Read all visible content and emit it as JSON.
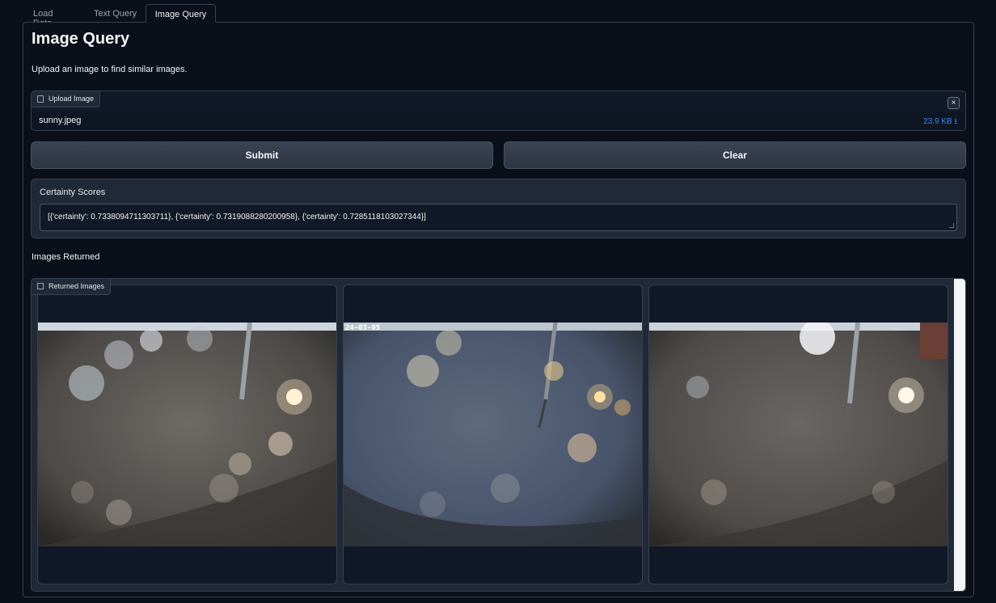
{
  "tabs": [
    {
      "label": "Load Data"
    },
    {
      "label": "Text Query"
    },
    {
      "label": "Image Query"
    }
  ],
  "active_tab": "Image Query",
  "page": {
    "title": "Image Query",
    "description": "Upload an image to find similar images."
  },
  "upload": {
    "label": "Upload Image",
    "icon": "file-icon",
    "file_name": "sunny.jpeg",
    "file_size": "23.9 KB ⭳",
    "close_symbol": "×"
  },
  "buttons": {
    "submit_label": "Submit",
    "clear_label": "Clear"
  },
  "scores": {
    "label": "Certainty Scores",
    "value": "[{'certainty': 0.7338094711303711}, {'certainty': 0.7319088280200958}, {'certainty': 0.7285118103027344}]"
  },
  "images_section": {
    "label": "Images Returned",
    "gallery_label": "Returned Images",
    "gallery_icon": "image-icon",
    "items": [
      {
        "stamp": ""
      },
      {
        "stamp": "24-03-05"
      },
      {
        "stamp": ""
      }
    ]
  },
  "colors": {
    "background": "#0b0f19",
    "panel": "#1f2937",
    "border": "#374151",
    "accent_link": "#3b82f6",
    "button": "#374151"
  }
}
